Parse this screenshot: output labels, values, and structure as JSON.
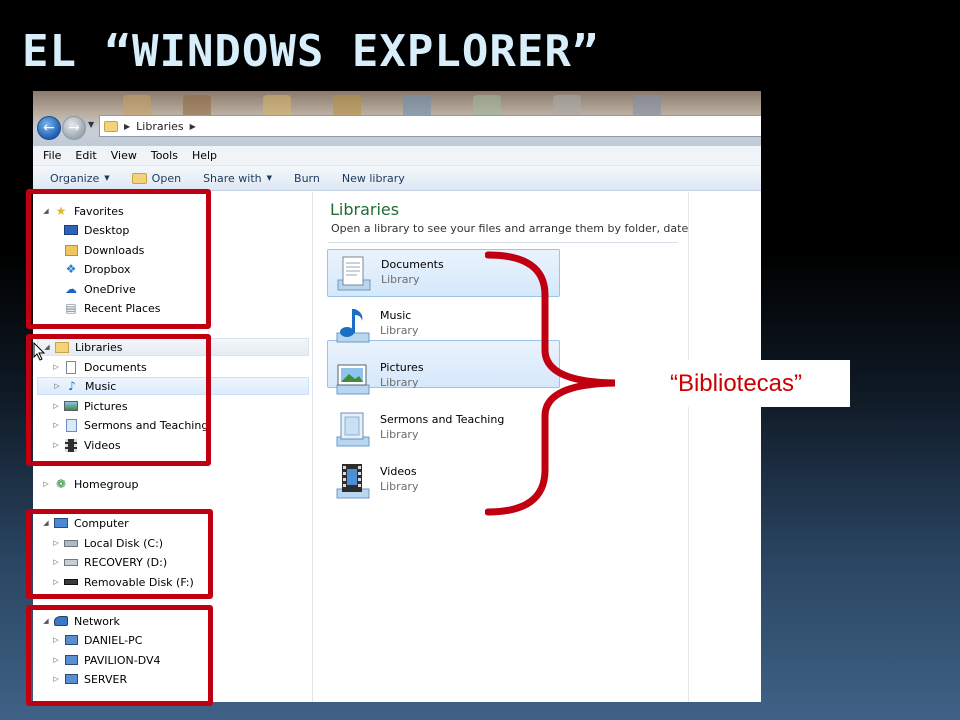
{
  "slide": {
    "title": "EL “WINDOWS EXPLORER”"
  },
  "window": {
    "address": {
      "breadcrumb": "Libraries"
    },
    "menu": [
      "File",
      "Edit",
      "View",
      "Tools",
      "Help"
    ],
    "toolbar": {
      "organize": "Organize",
      "open": "Open",
      "share_with": "Share with",
      "burn": "Burn",
      "new_library": "New library"
    },
    "nav_pane": {
      "favorites": {
        "label": "Favorites",
        "items": [
          "Desktop",
          "Downloads",
          "Dropbox",
          "OneDrive",
          "Recent Places"
        ]
      },
      "libraries": {
        "label": "Libraries",
        "items": [
          "Documents",
          "Music",
          "Pictures",
          "Sermons and Teaching",
          "Videos"
        ]
      },
      "homegroup": {
        "label": "Homegroup"
      },
      "computer": {
        "label": "Computer",
        "items": [
          "Local Disk (C:)",
          "RECOVERY (D:)",
          "Removable Disk (F:)"
        ]
      },
      "network": {
        "label": "Network",
        "items": [
          "DANIEL-PC",
          "PAVILION-DV4",
          "SERVER"
        ]
      }
    },
    "content": {
      "title": "Libraries",
      "subtitle": "Open a library to see your files and arrange them by folder, date, ...",
      "libraries": [
        {
          "name": "Documents",
          "type": "Library",
          "icon": "documents-library-icon"
        },
        {
          "name": "Music",
          "type": "Library",
          "icon": "music-library-icon"
        },
        {
          "name": "Pictures",
          "type": "Library",
          "icon": "pictures-library-icon"
        },
        {
          "name": "Sermons and Teaching",
          "type": "Library",
          "icon": "custom-library-icon"
        },
        {
          "name": "Videos",
          "type": "Library",
          "icon": "videos-library-icon"
        }
      ]
    }
  },
  "annotation": {
    "callout": "“Bibliotecas”",
    "color": "#c00010"
  },
  "colors": {
    "title_text": "#d9eefb",
    "content_title": "#1e6d32",
    "selection": "#dcebfc"
  }
}
